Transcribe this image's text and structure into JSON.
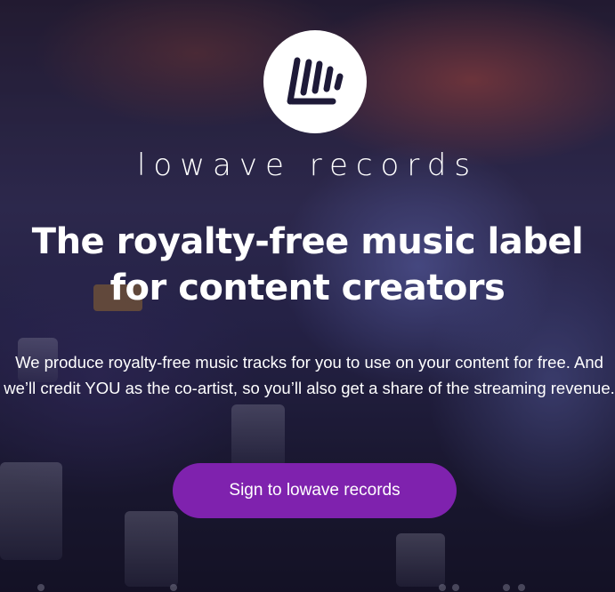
{
  "brand": {
    "logo_icon": "lowave-logo-icon",
    "name": "lowave records"
  },
  "hero": {
    "headline": "The royalty-free music label for content creators",
    "description": "We produce royalty-free music tracks for you to use on your content for free. And we’ll credit YOU as the co-artist, so you’ll also get a share of the streaming revenue.",
    "cta_label": "Sign to lowave records"
  },
  "colors": {
    "cta_background": "#7f22ae",
    "logo_background": "#ffffff",
    "logo_mark": "#1e1a38",
    "text": "#ffffff"
  }
}
